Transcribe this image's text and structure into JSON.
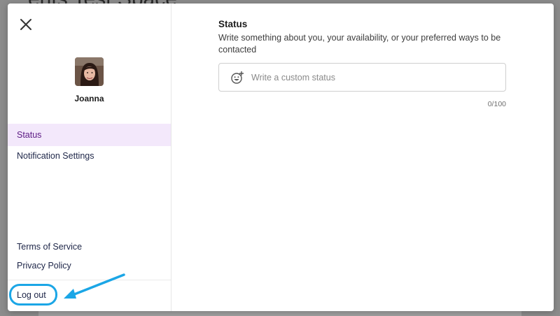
{
  "background": {
    "title": "ents Test Space"
  },
  "modal": {
    "close_icon": "close-icon",
    "user": {
      "name": "Joanna",
      "avatar": "avatar-photo"
    },
    "nav": {
      "items": [
        {
          "label": "Status",
          "active": true
        },
        {
          "label": "Notification Settings",
          "active": false
        }
      ]
    },
    "footer": {
      "terms": "Terms of Service",
      "privacy": "Privacy Policy",
      "logout": "Log out"
    },
    "status_panel": {
      "title": "Status",
      "description": "Write something about you, your availability, or your preferred ways to be contacted",
      "input": {
        "placeholder": "Write a custom status",
        "value": "",
        "emoji_icon": "emoji-add-icon"
      },
      "char_count": "0/100"
    }
  },
  "colors": {
    "accent": "#5c1a84",
    "active_bg": "#f3e8fb",
    "annotation": "#1ba6e6"
  }
}
